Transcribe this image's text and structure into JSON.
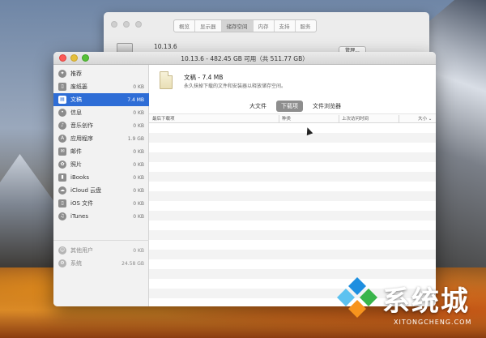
{
  "back_window": {
    "tabs": [
      {
        "label": "概览",
        "active": false
      },
      {
        "label": "显示器",
        "active": false
      },
      {
        "label": "储存空间",
        "active": true
      },
      {
        "label": "内存",
        "active": false
      },
      {
        "label": "支持",
        "active": false
      },
      {
        "label": "服务",
        "active": false
      }
    ],
    "version": "10.13.6",
    "manage_label": "管理..."
  },
  "main_window": {
    "title": "10.13.6 - 482.45 GB 可用（共 511.77 GB）"
  },
  "sidebar": {
    "items": [
      {
        "label": "推荐",
        "size": "",
        "icon": "lightbulb-icon",
        "selected": false
      },
      {
        "label": "废纸篓",
        "size": "0 KB",
        "icon": "trash-icon",
        "selected": false
      },
      {
        "label": "文稿",
        "size": "7.4 MB",
        "icon": "document-icon",
        "selected": true
      },
      {
        "label": "信息",
        "size": "0 KB",
        "icon": "message-icon",
        "selected": false
      },
      {
        "label": "音乐创作",
        "size": "0 KB",
        "icon": "guitar-icon",
        "selected": false
      },
      {
        "label": "应用程序",
        "size": "1.9 GB",
        "icon": "apps-icon",
        "selected": false
      },
      {
        "label": "邮件",
        "size": "0 KB",
        "icon": "mail-icon",
        "selected": false
      },
      {
        "label": "照片",
        "size": "0 KB",
        "icon": "photos-icon",
        "selected": false
      },
      {
        "label": "iBooks",
        "size": "0 KB",
        "icon": "book-icon",
        "selected": false
      },
      {
        "label": "iCloud 云盘",
        "size": "0 KB",
        "icon": "cloud-icon",
        "selected": false
      },
      {
        "label": "iOS 文件",
        "size": "0 KB",
        "icon": "phone-icon",
        "selected": false
      },
      {
        "label": "iTunes",
        "size": "0 KB",
        "icon": "music-icon",
        "selected": false
      },
      {
        "label": "其他用户",
        "size": "0 KB",
        "icon": "users-icon",
        "selected": false
      },
      {
        "label": "系统",
        "size": "24.58 GB",
        "icon": "gear-icon",
        "selected": false
      }
    ]
  },
  "content": {
    "heading": "文稿 - 7.4 MB",
    "description": "永久抹掉下载的文件和安装器以释放储存空间。",
    "tabs": [
      {
        "label": "大文件",
        "active": false
      },
      {
        "label": "下载项",
        "active": true
      },
      {
        "label": "文件浏览器",
        "active": false
      }
    ],
    "columns": {
      "name": "最后下载项",
      "kind": "种类",
      "last_access": "上次访问时间",
      "size": "大小 ⌄"
    }
  },
  "watermark": {
    "text": "系统城",
    "url": "XITONGCHENG.COM",
    "colors": [
      "#1e8fe0",
      "#5dc2f0",
      "#39b54a",
      "#f7941d"
    ]
  }
}
